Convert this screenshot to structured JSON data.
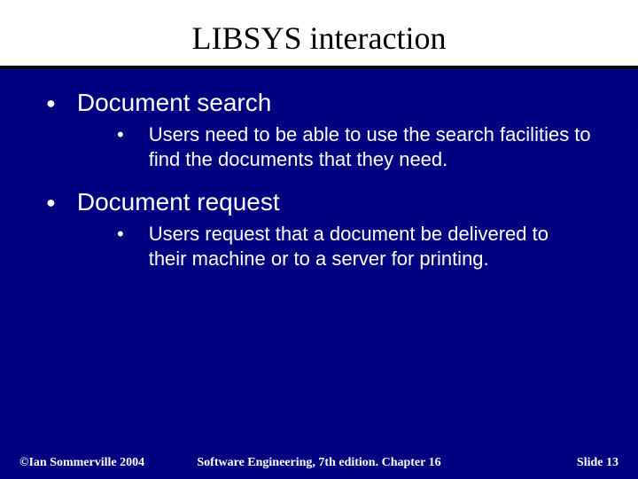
{
  "title": "LIBSYS interaction",
  "items": [
    {
      "label": "Document search",
      "sub": "Users need to be able to use the search facilities to find the documents that they need."
    },
    {
      "label": "Document request",
      "sub": "Users request that a document be delivered to their machine or to a server for printing."
    }
  ],
  "footer": {
    "left": "©Ian Sommerville 2004",
    "center": "Software Engineering, 7th edition. Chapter 16",
    "right": "Slide 13"
  }
}
